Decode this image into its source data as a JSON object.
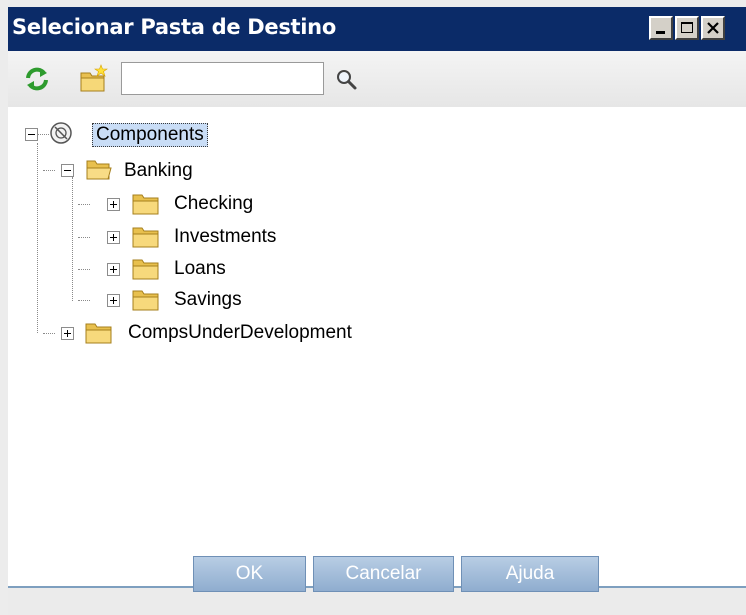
{
  "window": {
    "title": "Selecionar Pasta de Destino",
    "controls": [
      "minimize-icon",
      "maximize-icon",
      "close-icon"
    ]
  },
  "toolbar": {
    "refresh_icon": "refresh-icon",
    "new_folder_icon": "new-folder-icon",
    "search_value": "",
    "search_icon": "magnifier-icon"
  },
  "tree": {
    "root": {
      "label": "Components",
      "icon": "components-root-icon",
      "expanded": true,
      "selected": true
    },
    "banking": {
      "label": "Banking",
      "icon": "open-folder-icon",
      "expanded": true
    },
    "checking": {
      "label": "Checking",
      "icon": "folder-icon",
      "expanded": false
    },
    "investments": {
      "label": "Investments",
      "icon": "folder-icon",
      "expanded": false
    },
    "loans": {
      "label": "Loans",
      "icon": "folder-icon",
      "expanded": false
    },
    "savings": {
      "label": "Savings",
      "icon": "folder-icon",
      "expanded": false
    },
    "comps_dev": {
      "label": "CompsUnderDevelopment",
      "icon": "folder-icon",
      "expanded": false
    }
  },
  "buttons": {
    "ok": "OK",
    "cancel": "Cancelar",
    "help": "Ajuda"
  },
  "colors": {
    "titlebar": "#0b2b68",
    "selection": "#c9ddf6",
    "button": "#8fadcf",
    "divider": "#7e9fbf"
  }
}
